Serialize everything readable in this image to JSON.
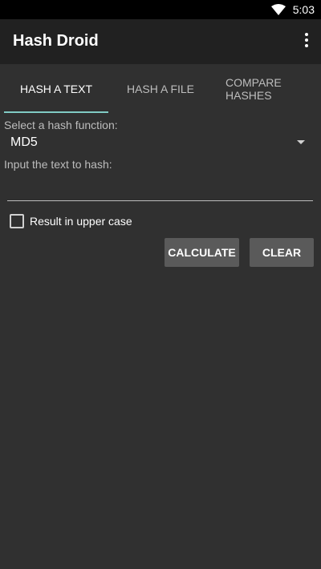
{
  "status_bar": {
    "time": "5:03"
  },
  "app_bar": {
    "title": "Hash Droid"
  },
  "tabs": [
    {
      "label": "HASH A TEXT"
    },
    {
      "label": "HASH A FILE"
    },
    {
      "label_line1": "COMPARE",
      "label_line2": "HASHES"
    }
  ],
  "form": {
    "hash_function_label": "Select a hash function:",
    "hash_function_value": "MD5",
    "text_input_label": "Input the text to hash:",
    "text_input_value": "",
    "uppercase_label": "Result in upper case",
    "uppercase_checked": false
  },
  "buttons": {
    "calculate": "CALCULATE",
    "clear": "CLEAR"
  },
  "colors": {
    "background": "#303030",
    "app_bar": "#212121",
    "accent": "#80cbc4",
    "button": "#5a5a5a"
  }
}
